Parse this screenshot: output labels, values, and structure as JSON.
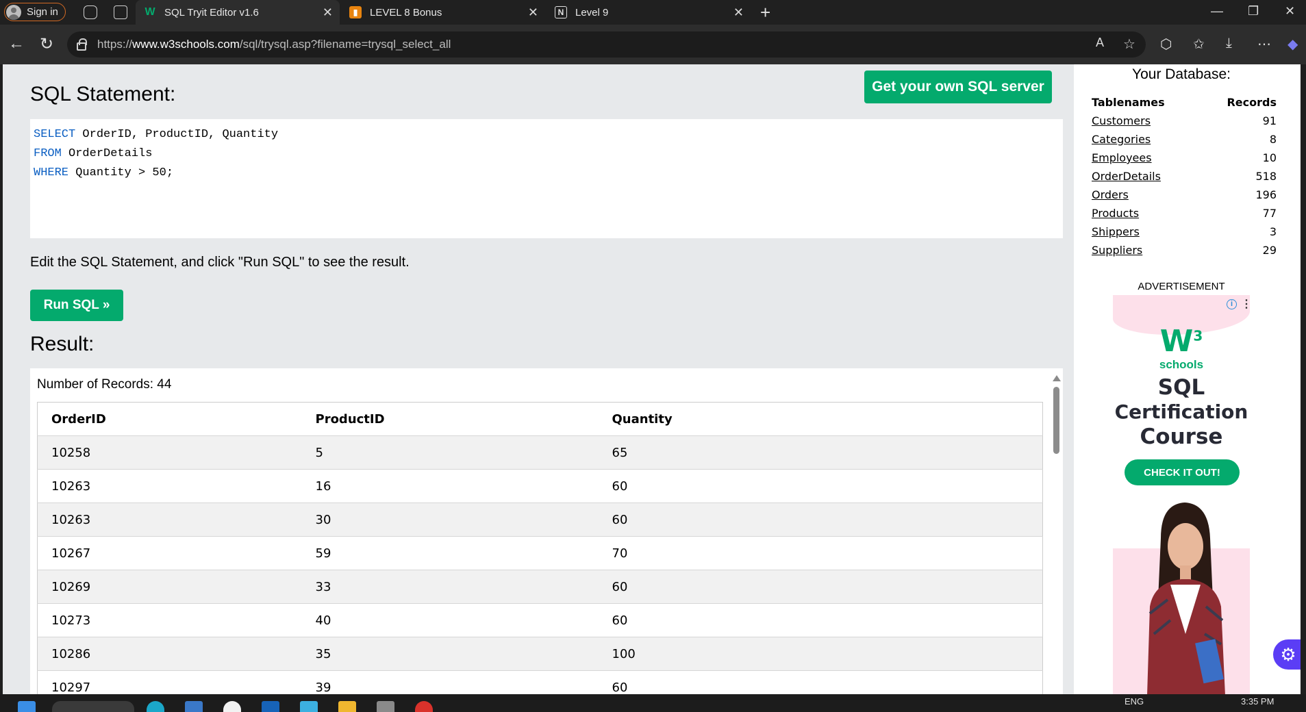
{
  "browser": {
    "sign_in": "Sign in",
    "tabs": [
      {
        "title": "SQL Tryit Editor v1.6",
        "active": true
      },
      {
        "title": "LEVEL 8 Bonus",
        "active": false
      },
      {
        "title": "Level 9",
        "active": false
      }
    ],
    "url_prefix": "https://",
    "url_host": "www.w3schools.com",
    "url_path": "/sql/trysql.asp?filename=trysql_select_all"
  },
  "editor": {
    "heading": "SQL Statement:",
    "own_server_button": "Get your own SQL server",
    "lines": [
      {
        "keyword": "SELECT",
        "rest": " OrderID, ProductID, Quantity"
      },
      {
        "keyword": "FROM",
        "rest": " OrderDetails"
      },
      {
        "keyword": "WHERE",
        "rest": " Quantity > 50;"
      }
    ],
    "instructions": "Edit the SQL Statement, and click \"Run SQL\" to see the result.",
    "run_button": "Run SQL »"
  },
  "result": {
    "heading": "Result:",
    "records_text": "Number of Records: 44",
    "columns": [
      "OrderID",
      "ProductID",
      "Quantity"
    ],
    "rows": [
      [
        "10258",
        "5",
        "65"
      ],
      [
        "10263",
        "16",
        "60"
      ],
      [
        "10263",
        "30",
        "60"
      ],
      [
        "10267",
        "59",
        "70"
      ],
      [
        "10269",
        "33",
        "60"
      ],
      [
        "10273",
        "40",
        "60"
      ],
      [
        "10286",
        "35",
        "100"
      ],
      [
        "10297",
        "39",
        "60"
      ]
    ]
  },
  "database": {
    "title": "Your Database:",
    "col_names": "Tablenames",
    "col_records": "Records",
    "tables": [
      {
        "name": "Customers",
        "records": "91"
      },
      {
        "name": "Categories",
        "records": "8"
      },
      {
        "name": "Employees",
        "records": "10"
      },
      {
        "name": "OrderDetails",
        "records": "518"
      },
      {
        "name": "Orders",
        "records": "196"
      },
      {
        "name": "Products",
        "records": "77"
      },
      {
        "name": "Shippers",
        "records": "3"
      },
      {
        "name": "Suppliers",
        "records": "29"
      }
    ]
  },
  "ad": {
    "label": "ADVERTISEMENT",
    "logo_w": "W",
    "logo_sup": "3",
    "logo_text": "schools",
    "headline_1": "SQL",
    "headline_2": "Certification",
    "headline_3": "Course",
    "cta": "CHECK IT OUT!"
  },
  "taskbar": {
    "lang": "ENG",
    "time": "3:35 PM"
  },
  "colors": {
    "accent_green": "#04aa6d",
    "keyword_blue": "#0a5ec2",
    "panel_grey": "#e7e9eb"
  }
}
